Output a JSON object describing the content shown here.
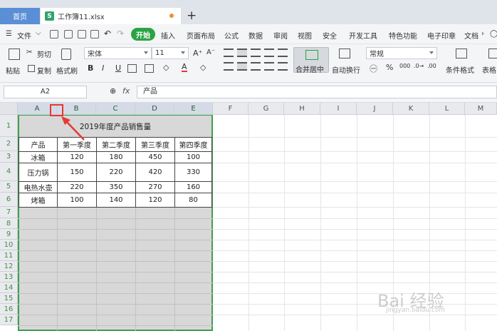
{
  "tabs": {
    "home": "首页",
    "file": "工作簿11.xlsx",
    "add": "+"
  },
  "menu": {
    "file": "文件",
    "items": [
      "开始",
      "插入",
      "页面布局",
      "公式",
      "数据",
      "审阅",
      "视图",
      "安全",
      "开发工具",
      "特色功能",
      "电子印章",
      "文档"
    ]
  },
  "ribbon": {
    "paste": "粘贴",
    "cut": "剪切",
    "copy": "复制",
    "format_painter": "格式刷",
    "font_name": "宋体",
    "font_size": "11",
    "bold": "B",
    "italic": "I",
    "underline": "U",
    "merge_center": "合并居中",
    "wrap": "自动换行",
    "number_format": "常规",
    "percent": "%",
    "cond_format": "条件格式",
    "table_style": "表格"
  },
  "formula": {
    "name_box": "A2",
    "fx": "fx",
    "content": "产品"
  },
  "columns": [
    "A",
    "B",
    "C",
    "D",
    "E",
    "F",
    "G",
    "H",
    "I",
    "J",
    "K",
    "L",
    "M"
  ],
  "rows": [
    "1",
    "2",
    "3",
    "4",
    "5",
    "6",
    "7",
    "8",
    "9",
    "10",
    "11",
    "12",
    "13",
    "14",
    "15",
    "16",
    "17"
  ],
  "sheet": {
    "title": "2019年度产品销售量",
    "headers": [
      "产品",
      "第一季度",
      "第二季度",
      "第三季度",
      "第四季度"
    ],
    "data": [
      [
        "冰箱",
        "120",
        "180",
        "450",
        "100"
      ],
      [
        "压力锅",
        "150",
        "220",
        "420",
        "330"
      ],
      [
        "电热水壶",
        "220",
        "350",
        "270",
        "160"
      ],
      [
        "烤箱",
        "100",
        "140",
        "120",
        "80"
      ]
    ]
  },
  "watermark": {
    "text": "Bai 经验",
    "sub": "jingyan.baidu.com"
  }
}
